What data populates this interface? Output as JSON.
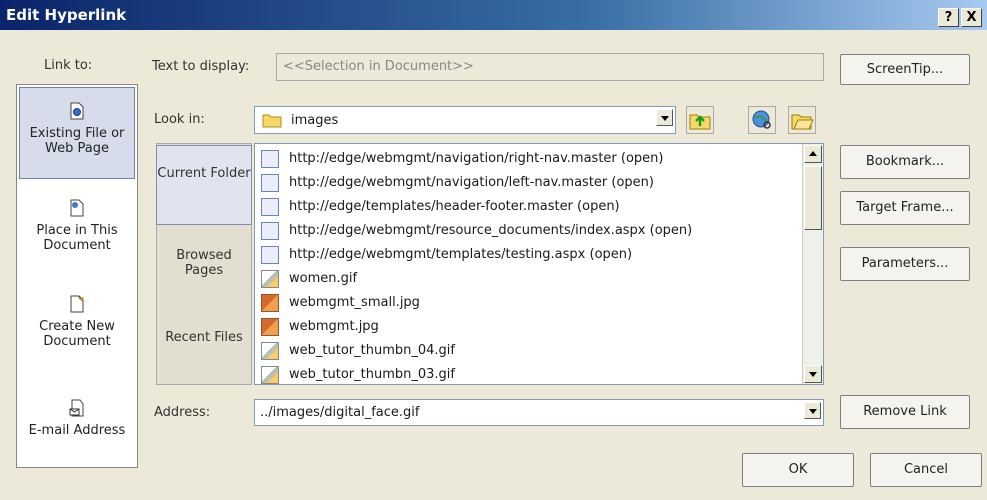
{
  "dialog": {
    "title": "Edit Hyperlink",
    "help_button": "?",
    "close_button": "X"
  },
  "link_to": {
    "label": "Link to:",
    "items": [
      {
        "label": "Existing File or Web Page",
        "icon": "existing-file-icon",
        "selected": true
      },
      {
        "label": "Place in This Document",
        "icon": "place-in-document-icon",
        "selected": false
      },
      {
        "label": "Create New Document",
        "icon": "new-document-icon",
        "selected": false
      },
      {
        "label": "E-mail Address",
        "icon": "email-address-icon",
        "selected": false
      }
    ]
  },
  "text_to_display": {
    "label": "Text to display:",
    "value": "<<Selection in Document>>"
  },
  "look_in": {
    "label": "Look in:",
    "value": "images"
  },
  "side_tabs": [
    {
      "label": "Current Folder",
      "selected": true
    },
    {
      "label": "Browsed Pages",
      "selected": false
    },
    {
      "label": "Recent Files",
      "selected": false
    }
  ],
  "files": [
    {
      "name": "http://edge/webmgmt/navigation/right-nav.master (open)",
      "icon": "page-icon"
    },
    {
      "name": "http://edge/webmgmt/navigation/left-nav.master (open)",
      "icon": "page-icon"
    },
    {
      "name": "http://edge/templates/header-footer.master (open)",
      "icon": "page-icon"
    },
    {
      "name": "http://edge/webmgmt/resource_documents/index.aspx (open)",
      "icon": "page-icon"
    },
    {
      "name": "http://edge/webmgmt/templates/testing.aspx (open)",
      "icon": "page-icon"
    },
    {
      "name": "women.gif",
      "icon": "gif-image-icon"
    },
    {
      "name": "webmgmt_small.jpg",
      "icon": "jpg-image-icon"
    },
    {
      "name": "webmgmt.jpg",
      "icon": "jpg-image-icon"
    },
    {
      "name": "web_tutor_thumbn_04.gif",
      "icon": "gif-image-icon"
    },
    {
      "name": "web_tutor_thumbn_03.gif",
      "icon": "gif-image-icon"
    }
  ],
  "address": {
    "label": "Address:",
    "value": "../images/digital_face.gif"
  },
  "buttons": {
    "screentip": "ScreenTip...",
    "bookmark": "Bookmark...",
    "target_frame": "Target Frame...",
    "parameters": "Parameters...",
    "remove_link": "Remove Link",
    "ok": "OK",
    "cancel": "Cancel"
  },
  "colors": {
    "title_bar": "#0a246a",
    "dialog_bg": "#ece9d8",
    "selection": "#d6dcea"
  }
}
